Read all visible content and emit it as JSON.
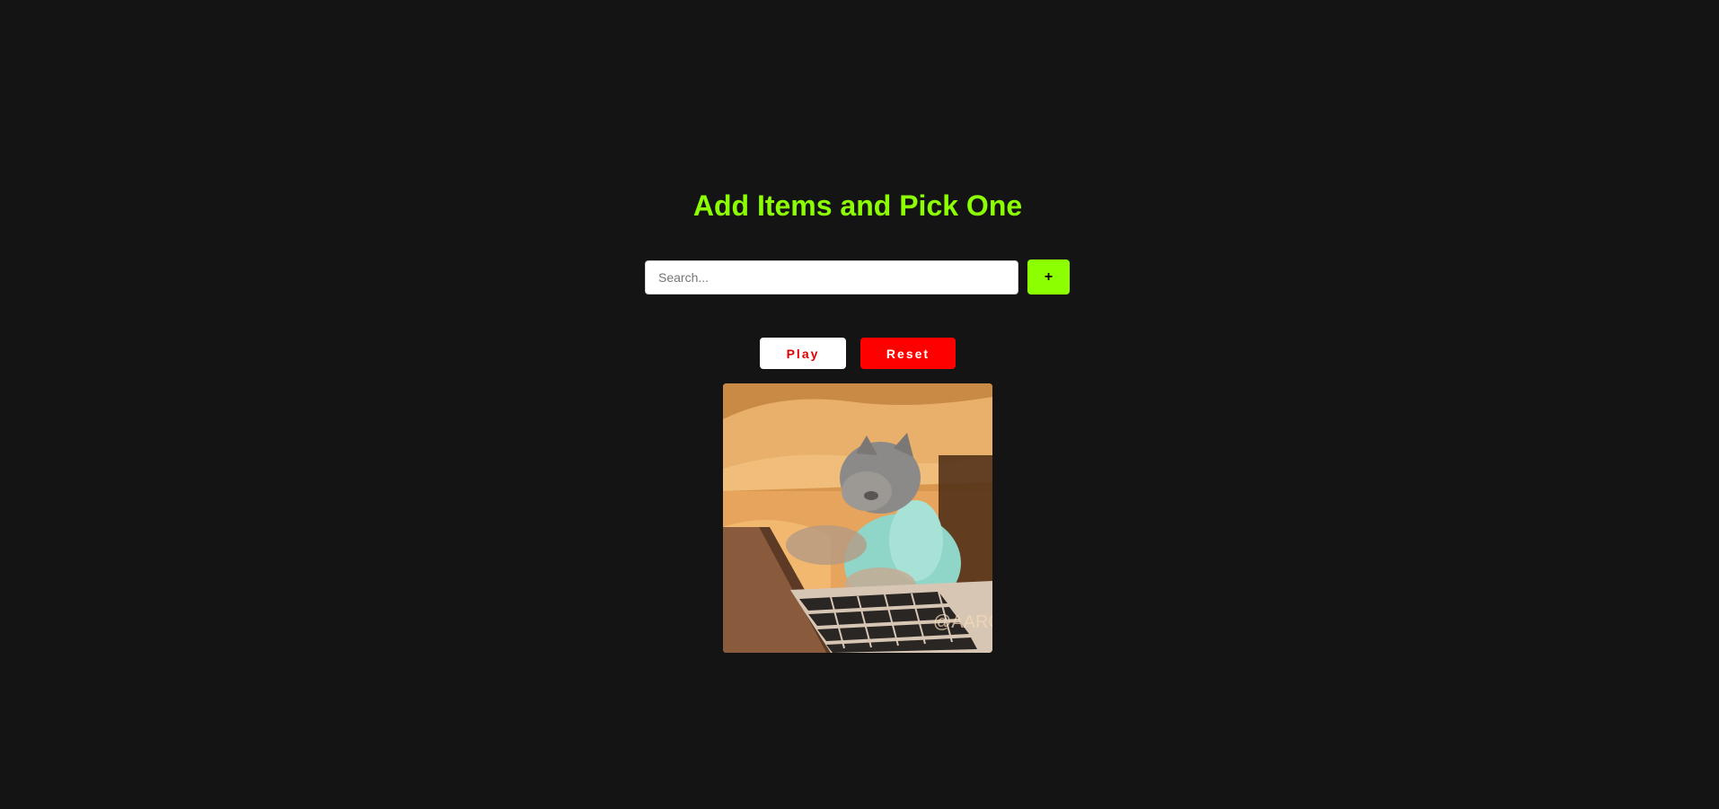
{
  "page": {
    "title": "Add Items and Pick One"
  },
  "search": {
    "placeholder": "Search...",
    "value": "",
    "add_label": "+"
  },
  "controls": {
    "play_label": "Play",
    "reset_label": "Reset"
  },
  "gif": {
    "watermark": "@AARON",
    "alt": "cat typing on laptop"
  },
  "colors": {
    "background": "#141414",
    "accent": "#8cff00",
    "danger": "#ff0000",
    "play_text": "#e00000"
  }
}
